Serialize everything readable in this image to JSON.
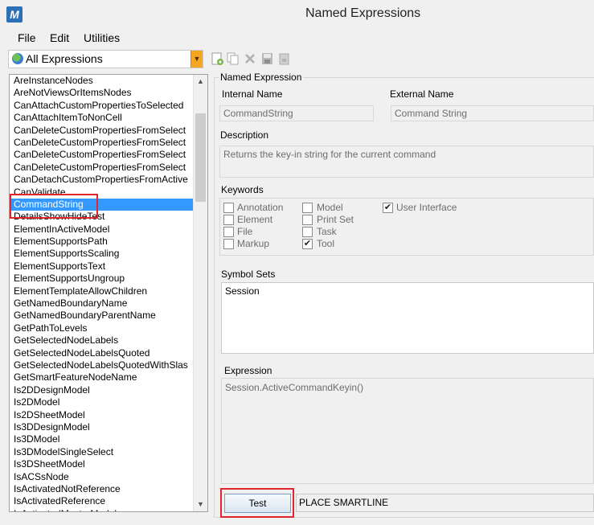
{
  "window": {
    "title": "Named Expressions",
    "app_icon": "microstation-logo-icon"
  },
  "menu": [
    "File",
    "Edit",
    "Utilities"
  ],
  "filter": {
    "selected": "All Expressions"
  },
  "toolbar": {
    "buttons": [
      "new-expression-icon",
      "copy-expression-icon",
      "delete-icon",
      "save-icon",
      "undo-save-icon"
    ]
  },
  "list": {
    "items": [
      "AreInstanceNodes",
      "AreNotViewsOrItemsNodes",
      "CanAttachCustomPropertiesToSelected",
      "CanAttachItemToNonCell",
      "CanDeleteCustomPropertiesFromSelect",
      "CanDeleteCustomPropertiesFromSelect",
      "CanDeleteCustomPropertiesFromSelect",
      "CanDeleteCustomPropertiesFromSelect",
      "CanDetachCustomPropertiesFromActive",
      "CanValidate",
      "CommandString",
      "DetailsShowHideTest",
      "ElementInActiveModel",
      "ElementSupportsPath",
      "ElementSupportsScaling",
      "ElementSupportsText",
      "ElementSupportsUngroup",
      "ElementTemplateAllowChildren",
      "GetNamedBoundaryName",
      "GetNamedBoundaryParentName",
      "GetPathToLevels",
      "GetSelectedNodeLabels",
      "GetSelectedNodeLabelsQuoted",
      "GetSelectedNodeLabelsQuotedWithSlas",
      "GetSmartFeatureNodeName",
      "Is2DDesignModel",
      "Is2DModel",
      "Is2DSheetModel",
      "Is3DDesignModel",
      "Is3DModel",
      "Is3DModelSingleSelect",
      "Is3DSheetModel",
      "IsACSsNode",
      "IsActivatedNotReference",
      "IsActivatedReference",
      "IsActivatedMasterModel"
    ],
    "selected_index": 10
  },
  "detail": {
    "section_title": "Named Expression",
    "internal_name_label": "Internal Name",
    "internal_name_value": "CommandString",
    "external_name_label": "External Name",
    "external_name_value": "Command String",
    "description_label": "Description",
    "description_value": "Returns the key-in string for the current command",
    "keywords_label": "Keywords",
    "keywords": [
      {
        "label": "Annotation",
        "checked": false
      },
      {
        "label": "Element",
        "checked": false
      },
      {
        "label": "File",
        "checked": false
      },
      {
        "label": "Markup",
        "checked": false
      },
      {
        "label": "Model",
        "checked": false
      },
      {
        "label": "Print Set",
        "checked": false
      },
      {
        "label": "Task",
        "checked": false
      },
      {
        "label": "Tool",
        "checked": true
      },
      {
        "label": "User Interface",
        "checked": true
      }
    ],
    "symbol_sets_label": "Symbol Sets",
    "symbol_sets": [
      "Session"
    ],
    "expression_label": "Expression",
    "expression_value": "Session.ActiveCommandKeyin()",
    "test_button": "Test",
    "test_result": "PLACE SMARTLINE"
  }
}
